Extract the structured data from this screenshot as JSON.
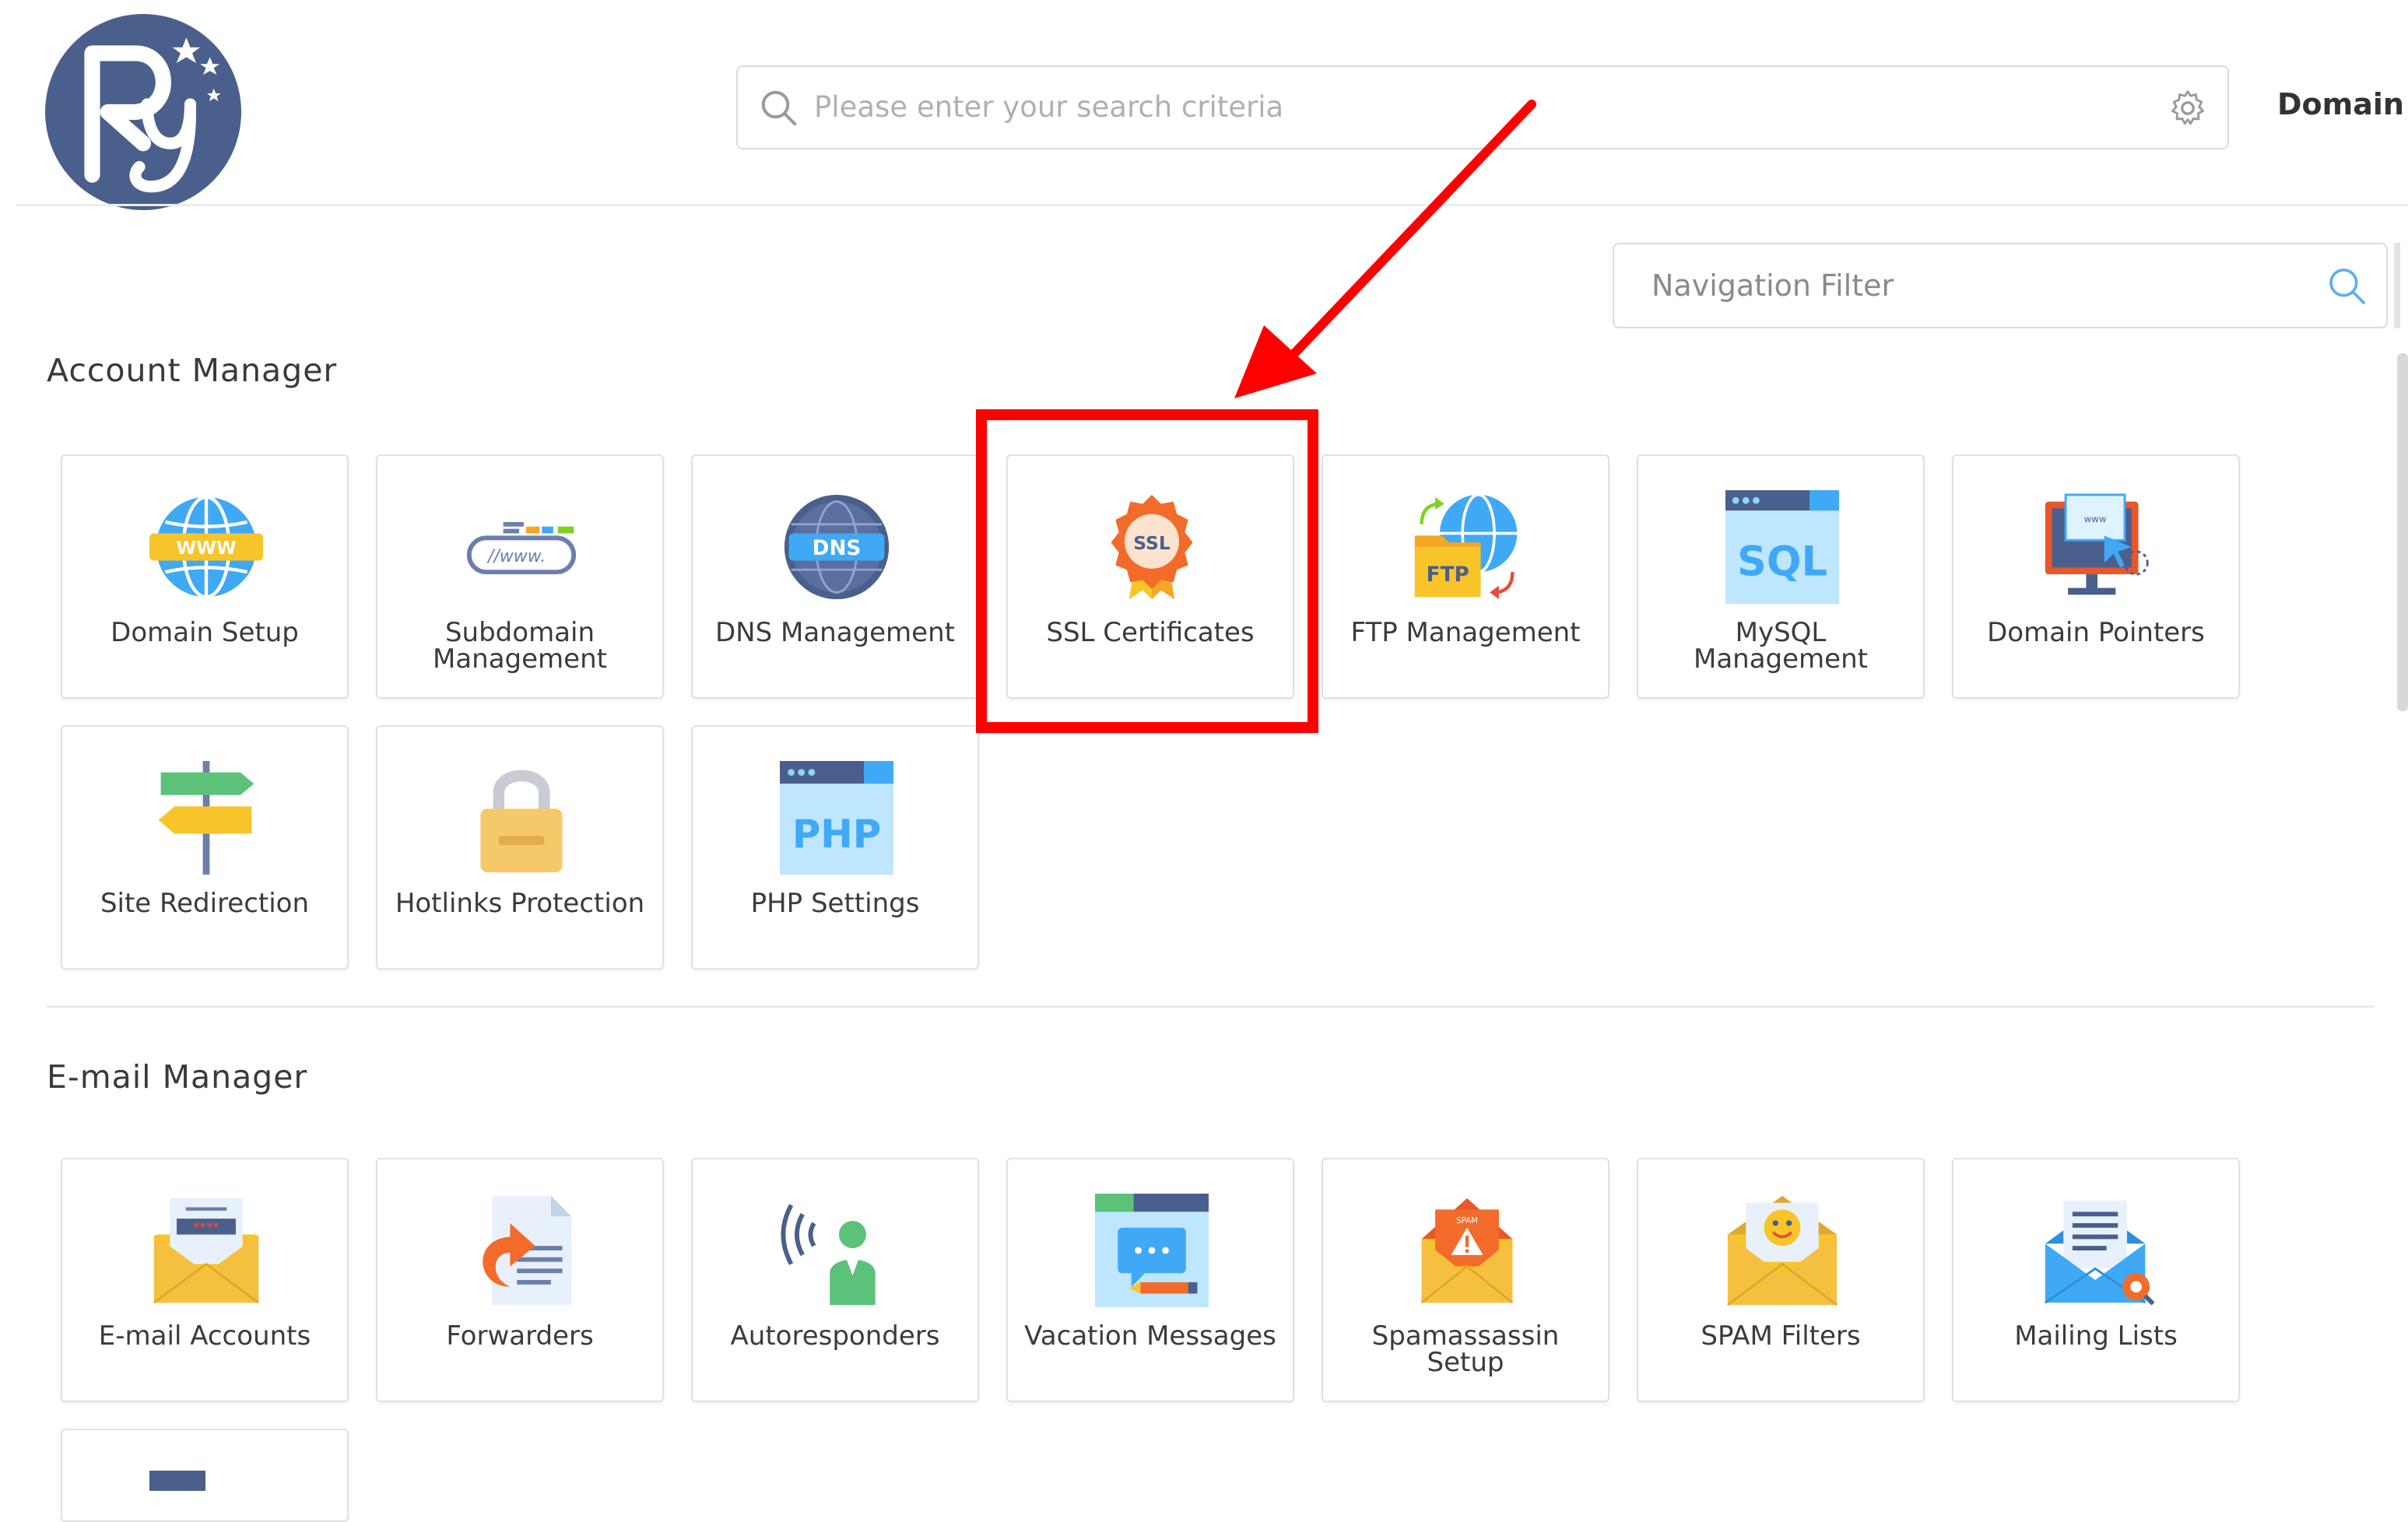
{
  "header": {
    "search_placeholder": "Please enter your search criteria",
    "domain_label": "Domain"
  },
  "nav_filter": {
    "placeholder": "Navigation Filter"
  },
  "account_manager": {
    "title": "Account Manager",
    "tiles": [
      {
        "label": "Domain Setup",
        "icon": "globe-www-icon"
      },
      {
        "label": "Subdomain Management",
        "icon": "subdomain-www-icon"
      },
      {
        "label": "DNS Management",
        "icon": "dns-globe-icon"
      },
      {
        "label": "SSL Certificates",
        "icon": "ssl-badge-icon"
      },
      {
        "label": "FTP Management",
        "icon": "ftp-folder-icon"
      },
      {
        "label": "MySQL Management",
        "icon": "sql-database-icon"
      },
      {
        "label": "Domain Pointers",
        "icon": "domain-pointer-icon"
      },
      {
        "label": "Site Redirection",
        "icon": "signpost-icon"
      },
      {
        "label": "Hotlinks Protection",
        "icon": "padlock-icon"
      },
      {
        "label": "PHP Settings",
        "icon": "php-window-icon"
      }
    ]
  },
  "email_manager": {
    "title": "E-mail Manager",
    "tiles": [
      {
        "label": "E-mail Accounts",
        "icon": "email-password-icon"
      },
      {
        "label": "Forwarders",
        "icon": "forward-document-icon"
      },
      {
        "label": "Autoresponders",
        "icon": "autoresponder-icon"
      },
      {
        "label": "Vacation Messages",
        "icon": "vacation-chat-icon"
      },
      {
        "label": "Spamassassin Setup",
        "icon": "spam-warning-envelope-icon"
      },
      {
        "label": "SPAM Filters",
        "icon": "spam-filter-smiley-icon"
      },
      {
        "label": "Mailing Lists",
        "icon": "mailing-list-icon"
      }
    ]
  },
  "colors": {
    "annotation_red": "#ff0000",
    "logo_blue": "#4a5f8c"
  }
}
